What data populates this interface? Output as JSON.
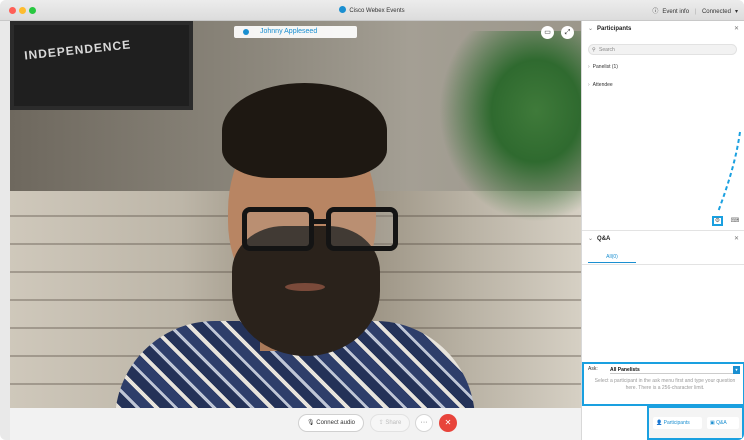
{
  "titlebar": {
    "app_title": "Cisco Webex Events",
    "event_info": "Event info",
    "separator": "|",
    "status": "Connected",
    "status_caret": "▾"
  },
  "video": {
    "participant_name": "Johnny Appleseed",
    "sign_text": "INDEPENDENCE"
  },
  "controls": {
    "connect_audio": "Connect audio",
    "share": "Share",
    "more": "···",
    "end": "✕"
  },
  "participants": {
    "header": "Participants",
    "search_placeholder": "Search",
    "groups": [
      {
        "label": "Panelist (1)"
      },
      {
        "label": "Attendee"
      }
    ]
  },
  "qa": {
    "header": "Q&A",
    "tab": "All(0)",
    "ask_label": "Ask:",
    "ask_value": "All Panelists",
    "hint": "Select a participant in the ask menu first and type your question here. There is a 256-character limit."
  },
  "bottom_bar": {
    "participants": "Participants",
    "qa": "Q&A"
  },
  "colors": {
    "accent": "#1a8fd1",
    "highlight": "#1aa0e0",
    "end_call": "#e8443b"
  }
}
